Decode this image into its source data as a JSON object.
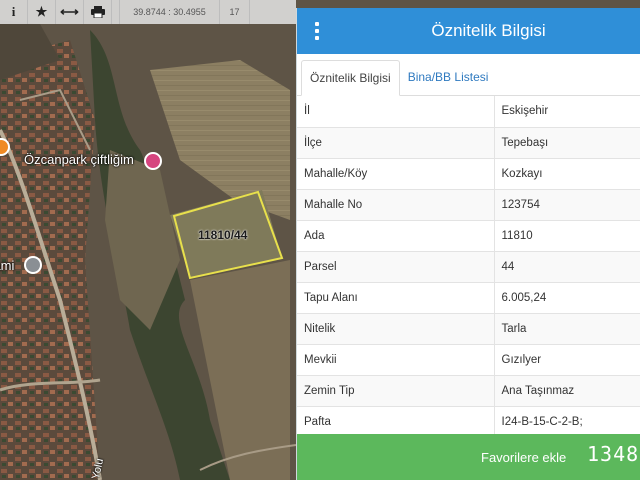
{
  "toolbar": {
    "items": [
      {
        "icon": "info-icon",
        "glyph": "i"
      },
      {
        "icon": "star-icon",
        "glyph": "★"
      },
      {
        "icon": "measure-arrows-icon",
        "glyph": "⟷"
      },
      {
        "icon": "print-icon",
        "glyph": "🖶"
      }
    ],
    "coordinates": "39.8744 : 30.4955",
    "zoom": "17"
  },
  "map": {
    "place_label": "Özcanpark çiftliğim",
    "mosque_label": "Cami",
    "street_label": "Yolu",
    "parcel_label": "11810/44",
    "colors": {
      "parcel_outline": "#e8e04c",
      "poi_pink": "#d6457f",
      "poi_gray": "#8a8f94",
      "poi_orange": "#f08a24"
    }
  },
  "panel": {
    "title": "Öznitelik Bilgisi",
    "header_color": "#2f8fd8",
    "tabs": [
      {
        "label": "Öznitelik Bilgisi",
        "active": true
      },
      {
        "label": "Bina/BB Listesi",
        "active": false
      }
    ],
    "rows": [
      {
        "key": "İl",
        "value": "Eskişehir"
      },
      {
        "key": "İlçe",
        "value": "Tepebaşı"
      },
      {
        "key": "Mahalle/Köy",
        "value": "Kozkayı"
      },
      {
        "key": "Mahalle No",
        "value": "123754"
      },
      {
        "key": "Ada",
        "value": "11810"
      },
      {
        "key": "Parsel",
        "value": "44"
      },
      {
        "key": "Tapu Alanı",
        "value": "6.005,24"
      },
      {
        "key": "Nitelik",
        "value": "Tarla"
      },
      {
        "key": "Mevkii",
        "value": "Gızılyer"
      },
      {
        "key": "Zemin Tip",
        "value": "Ana Taşınmaz"
      },
      {
        "key": "Pafta",
        "value": "I24-B-15-C-2-B;"
      }
    ],
    "favorites": {
      "label": "Favorilere ekle",
      "count": "1348",
      "color": "#5cb85c"
    }
  }
}
